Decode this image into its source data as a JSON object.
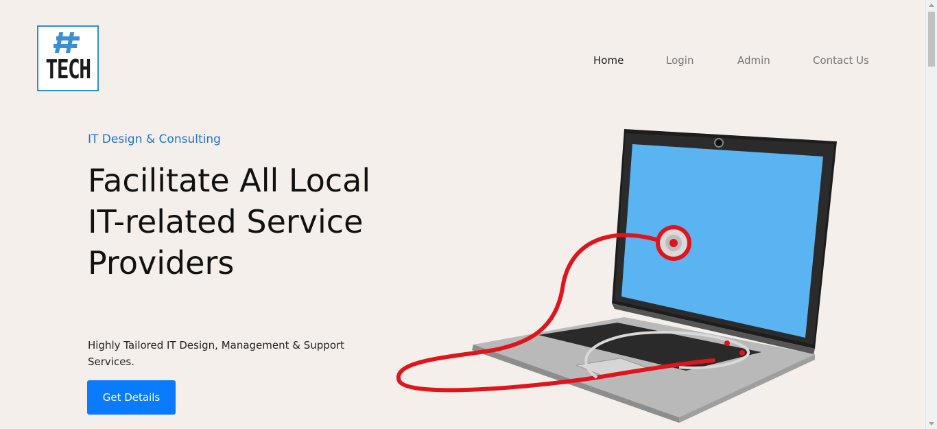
{
  "logo": {
    "text": "TECH",
    "icon": "hash-icon",
    "accent": "#2f8fd6",
    "hash_color": "#3b8fd4"
  },
  "nav": {
    "items": [
      {
        "label": "Home",
        "active": true
      },
      {
        "label": "Login",
        "active": false
      },
      {
        "label": "Admin",
        "active": false
      },
      {
        "label": "Contact Us",
        "active": false
      }
    ]
  },
  "hero": {
    "eyebrow": "IT Design & Consulting",
    "headline": "Facilitate All Local IT-related Service Providers",
    "subtext": "Highly Tailored IT Design, Management & Support Services.",
    "cta_label": "Get Details",
    "illustration": "laptop-with-stethoscope-image"
  },
  "colors": {
    "background": "#f4efea",
    "accent": "#0a7bff",
    "eyebrow": "#1e73d6",
    "screen": "#5ab4f2",
    "stethoscope": "#e0141c"
  }
}
